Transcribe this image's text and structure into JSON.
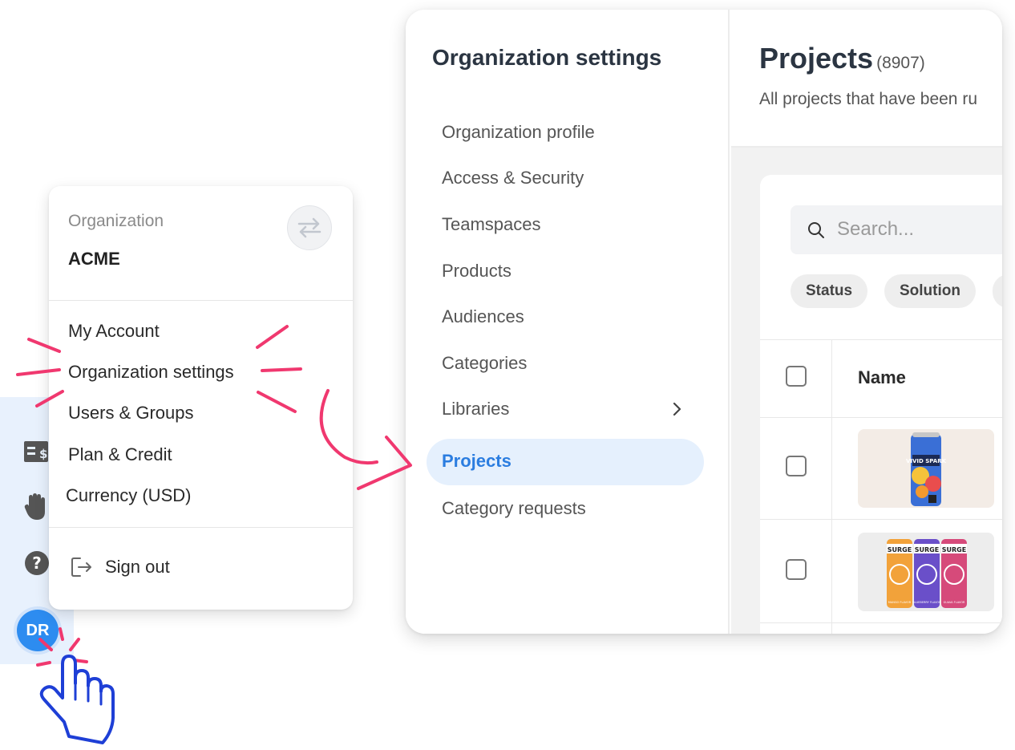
{
  "colors": {
    "accent": "#2b7de0",
    "annotation": "#f0386f",
    "cursor_outline": "#1e3fd6"
  },
  "rail": {
    "icons": [
      "billing-icon",
      "hand-icon",
      "help-icon"
    ],
    "avatar_initials": "DR"
  },
  "dropdown": {
    "org_label": "Organization",
    "org_name": "ACME",
    "items": [
      {
        "label": "My Account"
      },
      {
        "label": "Organization settings"
      },
      {
        "label": "Users & Groups"
      },
      {
        "label": "Plan & Credit"
      },
      {
        "label": "Currency (USD)"
      }
    ],
    "sign_out": "Sign out"
  },
  "settings": {
    "title": "Organization settings",
    "nav": [
      {
        "label": "Organization profile"
      },
      {
        "label": "Access & Security"
      },
      {
        "label": "Teamspaces"
      },
      {
        "label": "Products"
      },
      {
        "label": "Audiences"
      },
      {
        "label": "Categories"
      },
      {
        "label": "Libraries"
      },
      {
        "label": "Projects"
      },
      {
        "label": "Category requests"
      }
    ]
  },
  "main": {
    "title": "Projects",
    "count": "(8907)",
    "subtitle": "All projects that have been ru",
    "search_placeholder": "Search...",
    "chips": [
      "Status",
      "Solution"
    ],
    "table_header_name": "Name",
    "rows": [
      {
        "thumb_text": "VIVID SPARK"
      },
      {
        "thumb_texts": [
          "SURGE",
          "SURGE",
          "SURGE"
        ],
        "flavors": [
          "MANGO FLAVOR",
          "BLUEBERRY FLAVOR",
          "GUAVA FLAVOR"
        ]
      }
    ]
  }
}
